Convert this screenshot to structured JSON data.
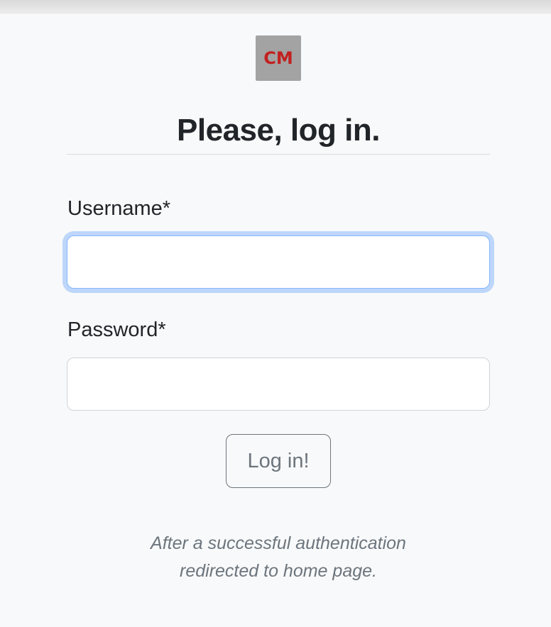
{
  "logo": {
    "text": "CM",
    "text_color": "#c22020",
    "background": "#a3a3a3"
  },
  "title": "Please, log in.",
  "form": {
    "username": {
      "label": "Username*",
      "value": "",
      "placeholder": ""
    },
    "password": {
      "label": "Password*",
      "value": "",
      "placeholder": ""
    },
    "submit_label": "Log in!"
  },
  "note": {
    "line1": "After a successful authentication",
    "line2": "redirected to home page."
  },
  "colors": {
    "background": "#f8f9fa",
    "focus_ring": "#86b7fe",
    "secondary": "#6c757d"
  }
}
